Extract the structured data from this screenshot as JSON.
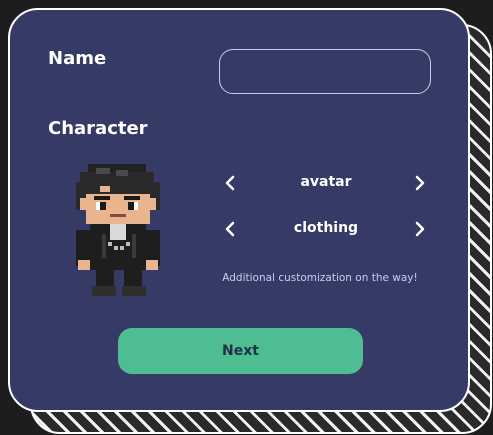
{
  "form": {
    "name_label": "Name",
    "name_value": "",
    "character_label": "Character",
    "avatar_label": "avatar",
    "clothing_label": "clothing",
    "note": "Additional customization on the way!",
    "next_label": "Next"
  },
  "colors": {
    "card": "#363a66",
    "button": "#4ebd91",
    "background": "#1d1d1f"
  },
  "icons": {
    "prev": "chevron-left-icon",
    "next": "chevron-right-icon",
    "avatar": "pixel-character-sprite"
  }
}
